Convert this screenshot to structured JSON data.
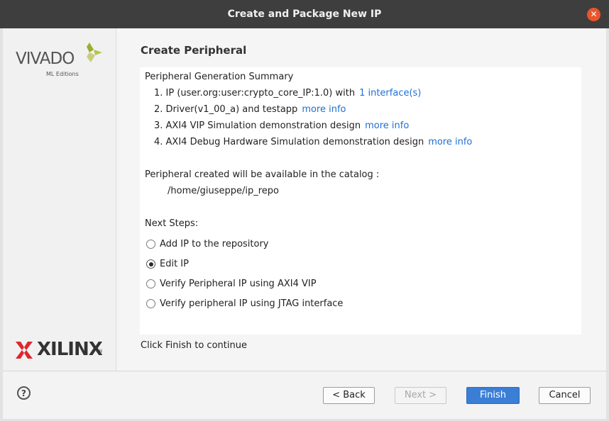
{
  "window": {
    "title": "Create and Package New IP",
    "close_glyph": "✕"
  },
  "sidebar": {
    "vivado_logo_text": "VIVADO",
    "vivado_logo_subtitle": "ML Editions",
    "xilinx_logo_text": "XILINX",
    "xilinx_logo_reg": "®"
  },
  "main": {
    "title": "Create Peripheral",
    "summary": {
      "heading": "Peripheral Generation Summary",
      "items": [
        {
          "text": "1. IP (user.org:user:crypto_core_IP:1.0) with",
          "link": "1 interface(s)"
        },
        {
          "text": "2. Driver(v1_00_a) and testapp",
          "link": "more info"
        },
        {
          "text": "3. AXI4 VIP Simulation demonstration design",
          "link": "more info"
        },
        {
          "text": "4. AXI4 Debug Hardware Simulation demonstration design",
          "link": "more info"
        }
      ]
    },
    "catalog": {
      "label": "Peripheral created will be available in the catalog :",
      "path": "/home/giuseppe/ip_repo"
    },
    "next_steps": {
      "label": "Next Steps:",
      "selected": "Edit IP",
      "options": [
        {
          "label": "Add IP to the repository",
          "checked": false
        },
        {
          "label": "Edit IP",
          "checked": true
        },
        {
          "label": "Verify Peripheral IP using AXI4 VIP",
          "checked": false
        },
        {
          "label": "Verify peripheral IP using JTAG interface",
          "checked": false
        }
      ]
    },
    "footer_note": "Click Finish to continue"
  },
  "buttons": {
    "help_glyph": "?",
    "back": "< Back",
    "next": "Next >",
    "finish": "Finish",
    "cancel": "Cancel"
  },
  "colors": {
    "titlebar": "#3e3e3e",
    "close_button": "#e9562b",
    "link": "#1f6fd6",
    "primary_button": "#3b7ed6",
    "vivado_leaf": "#9aae2f",
    "xilinx_red": "#e0252e"
  }
}
